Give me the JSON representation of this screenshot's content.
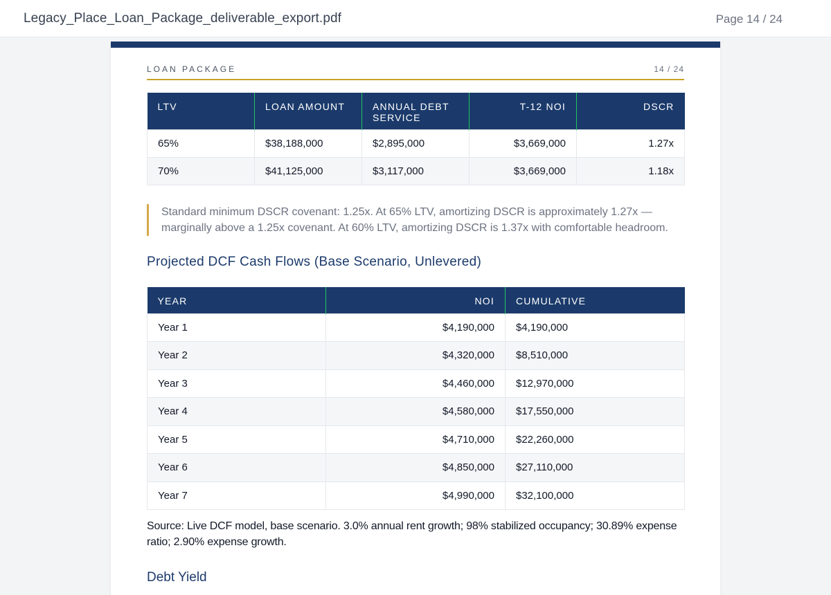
{
  "viewer": {
    "filename": "Legacy_Place_Loan_Package_deliverable_export.pdf",
    "page_indicator": "Page 14 / 24"
  },
  "running_head": {
    "section": "LOAN PACKAGE",
    "page": "14 / 24"
  },
  "ltv_table": {
    "headers": [
      "LTV",
      "LOAN AMOUNT",
      "ANNUAL DEBT SERVICE",
      "T-12 NOI",
      "DSCR"
    ],
    "rows": [
      [
        "65%",
        "$38,188,000",
        "$2,895,000",
        "$3,669,000",
        "1.27x"
      ],
      [
        "70%",
        "$41,125,000",
        "$3,117,000",
        "$3,669,000",
        "1.18x"
      ]
    ]
  },
  "callout": {
    "text": "Standard minimum DSCR covenant: 1.25x. At 65% LTV, amortizing DSCR is approximately 1.27x — marginally above a 1.25x covenant. At 60% LTV, amortizing DSCR is 1.37x with comfortable headroom."
  },
  "dcf_section": {
    "title": "Projected DCF Cash Flows (Base Scenario, Unlevered)"
  },
  "dcf_table": {
    "headers": [
      "YEAR",
      "NOI",
      "CUMULATIVE"
    ],
    "rows": [
      [
        "Year 1",
        "$4,190,000",
        "$4,190,000"
      ],
      [
        "Year 2",
        "$4,320,000",
        "$8,510,000"
      ],
      [
        "Year 3",
        "$4,460,000",
        "$12,970,000"
      ],
      [
        "Year 4",
        "$4,580,000",
        "$17,550,000"
      ],
      [
        "Year 5",
        "$4,710,000",
        "$22,260,000"
      ],
      [
        "Year 6",
        "$4,850,000",
        "$27,110,000"
      ],
      [
        "Year 7",
        "$4,990,000",
        "$32,100,000"
      ]
    ]
  },
  "source_note": "Source: Live DCF model, base scenario. 3.0% annual rent growth; 98% stabilized occupancy; 30.89% expense ratio; 2.90% expense growth.",
  "next_section": {
    "title": "Debt Yield"
  },
  "colors": {
    "header_navy": "#1b3a6b",
    "accent_gold": "#c9a227",
    "header_divider_green": "#22c55e"
  }
}
